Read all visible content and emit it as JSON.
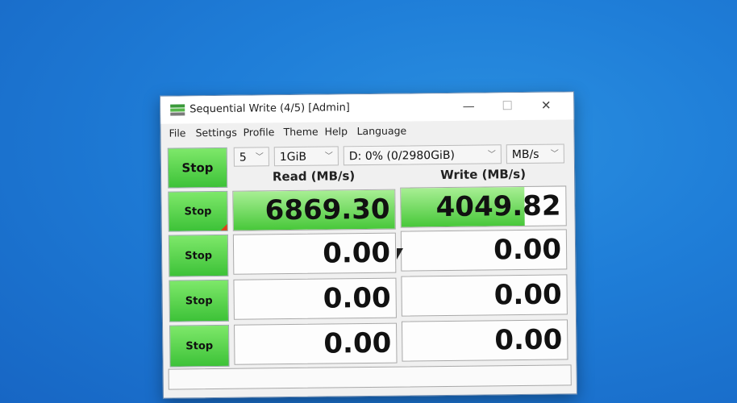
{
  "window": {
    "title": "Sequential Write (4/5) [Admin]",
    "controls": {
      "minimize": "—",
      "maximize": "☐",
      "close": "✕"
    }
  },
  "menu": [
    "File",
    "Settings",
    "Profile",
    "Theme",
    "Help",
    "Language"
  ],
  "toolbar": {
    "all_button": "Stop",
    "count": "5",
    "size": "1GiB",
    "drive": "D: 0% (0/2980GiB)",
    "unit": "MB/s"
  },
  "columns": {
    "read": "Read (MB/s)",
    "write": "Write (MB/s)"
  },
  "rows": [
    {
      "button": "Stop",
      "read": "6869.30",
      "write": "4049.82",
      "read_fill": 1.0,
      "write_fill": 0.75
    },
    {
      "button": "Stop",
      "read": "0.00",
      "write": "0.00",
      "read_fill": 0,
      "write_fill": 0
    },
    {
      "button": "Stop",
      "read": "0.00",
      "write": "0.00",
      "read_fill": 0,
      "write_fill": 0
    },
    {
      "button": "Stop",
      "read": "0.00",
      "write": "0.00",
      "read_fill": 0,
      "write_fill": 0
    }
  ],
  "status": "",
  "colors": {
    "accent_green": "#3dc238",
    "desktop_blue": "#1f7ed8",
    "progress_marker": "#e0401a"
  }
}
